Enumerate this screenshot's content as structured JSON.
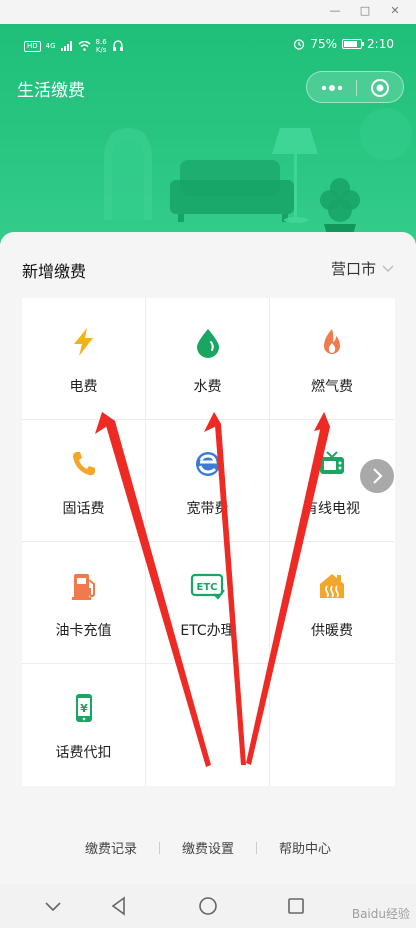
{
  "status_bar": {
    "network": "HD",
    "signal": "4G",
    "speed_value": "8.6",
    "speed_unit": "K/s",
    "battery": "75%",
    "time": "2:10"
  },
  "header": {
    "title": "生活缴费"
  },
  "section": {
    "title": "新增缴费",
    "city": "营口市"
  },
  "services": [
    {
      "label": "电费",
      "icon": "lightning-icon",
      "color": "#f2b21e"
    },
    {
      "label": "水费",
      "icon": "water-drop-icon",
      "color": "#1aa563"
    },
    {
      "label": "燃气费",
      "icon": "flame-icon",
      "color": "#f07a4c"
    },
    {
      "label": "固话费",
      "icon": "phone-icon",
      "color": "#f4a62a"
    },
    {
      "label": "宽带费",
      "icon": "broadband-icon",
      "color": "#3a7bd5"
    },
    {
      "label": "有线电视",
      "icon": "tv-icon",
      "color": "#1aa563"
    },
    {
      "label": "油卡充值",
      "icon": "fuel-pump-icon",
      "color": "#f07a4c"
    },
    {
      "label": "ETC办理",
      "icon": "etc-icon",
      "color": "#1aa563"
    },
    {
      "label": "供暖费",
      "icon": "heating-icon",
      "color": "#f4a62a"
    },
    {
      "label": "话费代扣",
      "icon": "mobile-yuan-icon",
      "color": "#1aa563"
    }
  ],
  "footer": {
    "links": [
      "缴费记录",
      "缴费设置",
      "帮助中心"
    ]
  },
  "watermark": "Baidu经验",
  "colors": {
    "brand": "#2ac683",
    "annotation": "#ee2a24"
  }
}
